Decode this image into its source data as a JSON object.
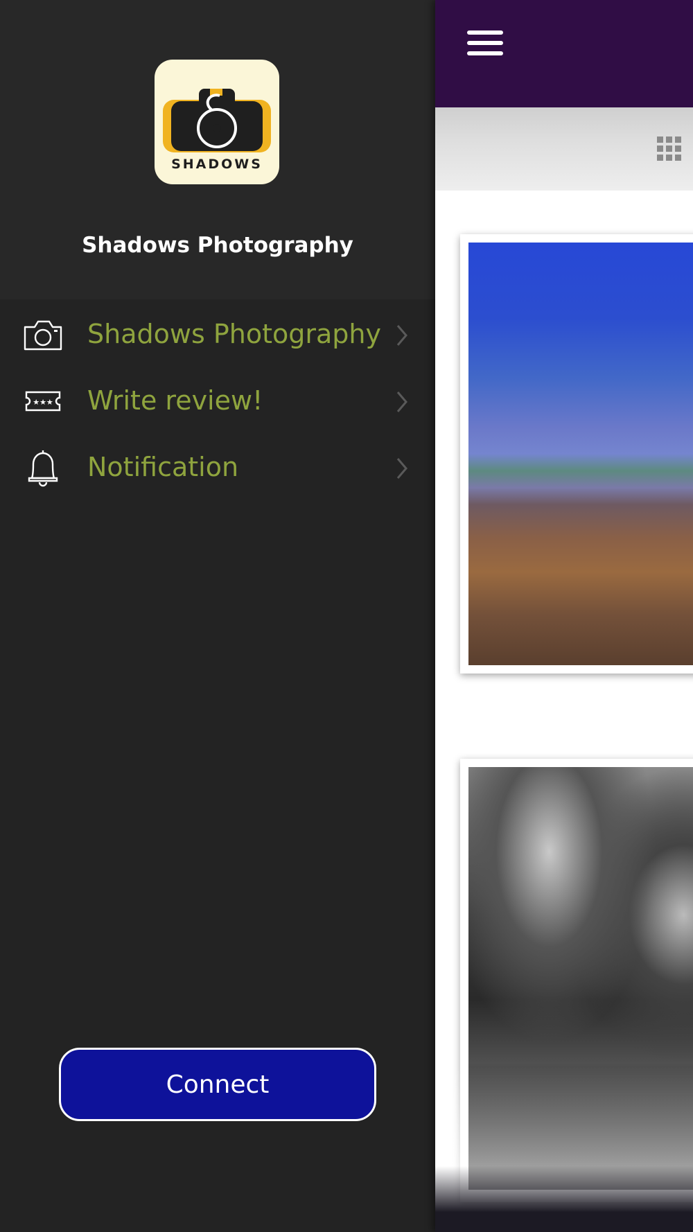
{
  "drawer": {
    "app_logo_text": "SHADOWS",
    "app_name": "Shadows Photography",
    "menu_items": [
      {
        "label": "Shadows Photography",
        "icon": "camera-icon"
      },
      {
        "label": "Write review!",
        "icon": "rating-ticket-icon"
      },
      {
        "label": "Notification",
        "icon": "bell-icon"
      }
    ],
    "connect_label": "Connect"
  },
  "main": {
    "menu_icon": "hamburger-menu-icon",
    "view_icon": "grid-view-icon",
    "photos": [
      {
        "subject": "mountain-landscape-photo"
      },
      {
        "subject": "black-and-white-trees-photo"
      }
    ]
  },
  "colors": {
    "drawer_background": "#232323",
    "menu_text": "#8fa43e",
    "top_bar": "#300d45",
    "connect_button": "#0e129a"
  }
}
